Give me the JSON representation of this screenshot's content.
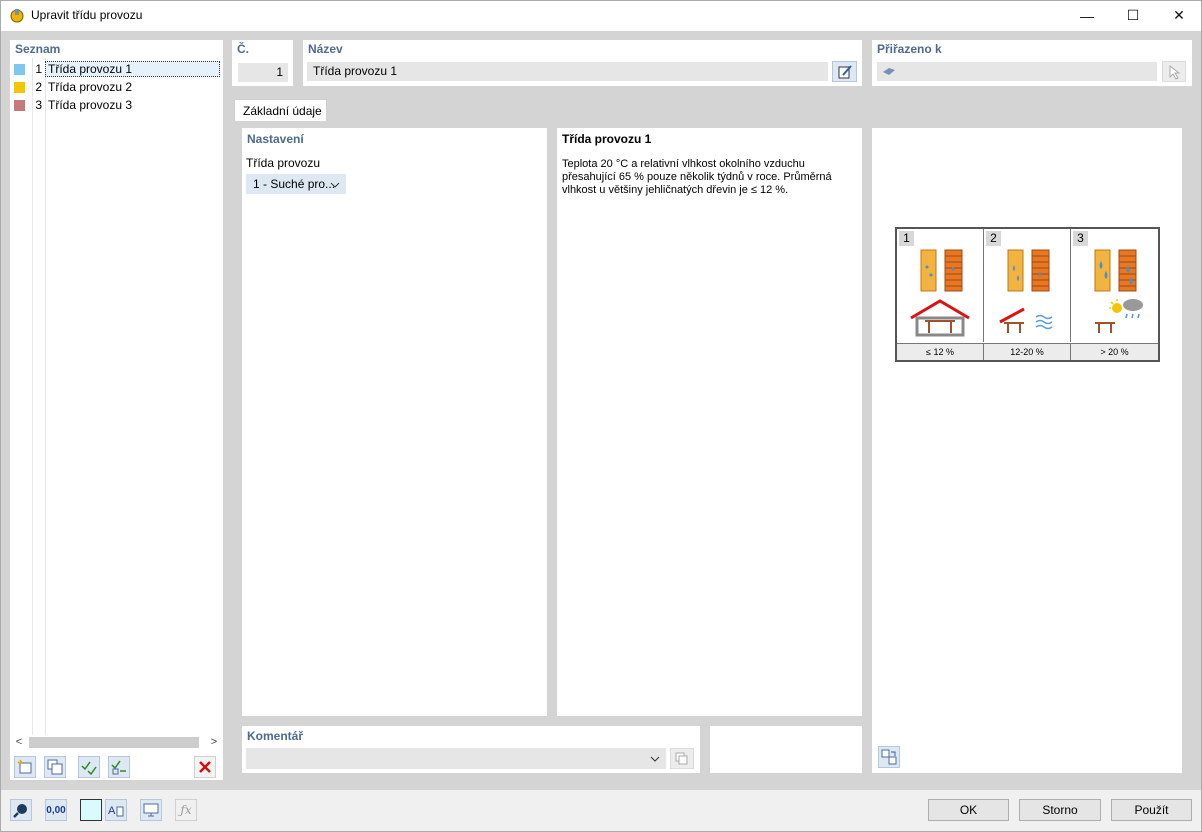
{
  "window": {
    "title": "Upravit třídu provozu",
    "minimize": "—",
    "maximize": "☐",
    "close": "✕"
  },
  "list": {
    "header": "Seznam",
    "items": [
      {
        "num": "1",
        "label": "Třída provozu 1",
        "color": "#7ec8f0"
      },
      {
        "num": "2",
        "label": "Třída provozu 2",
        "color": "#f5c400"
      },
      {
        "num": "3",
        "label": "Třída provozu 3",
        "color": "#c57a7a"
      }
    ]
  },
  "header": {
    "no_label": "Č.",
    "no_value": "1",
    "name_label": "Název",
    "name_value": "Třída provozu 1",
    "assigned_label": "Přiřazeno k"
  },
  "tabs": [
    {
      "label": "Základní údaje"
    }
  ],
  "settings": {
    "header": "Nastavení",
    "class_label": "Třída provozu",
    "class_value": "1 - Suché pro..."
  },
  "description": {
    "title": "Třída provozu 1",
    "text": "Teplota 20 °C a relativní vlhkost okolního vzduchu přesahující 65 % pouze několik týdnů v roce. Průměrná vlhkost u většiny jehličnatých dřevin je ≤ 12 %."
  },
  "diagram": {
    "cells": [
      {
        "num": "1",
        "label": "≤ 12 %"
      },
      {
        "num": "2",
        "label": "12-20 %"
      },
      {
        "num": "3",
        "label": "> 20 %"
      }
    ]
  },
  "comment": {
    "label": "Komentář",
    "value": ""
  },
  "buttons": {
    "ok": "OK",
    "cancel": "Storno",
    "apply": "Použít"
  },
  "footer": {
    "decimal_label": "0,00"
  }
}
